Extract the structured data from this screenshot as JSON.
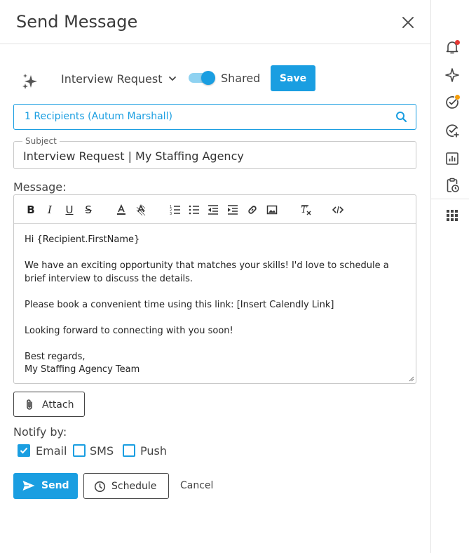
{
  "header": {
    "title": "Send Message"
  },
  "template": {
    "selected": "Interview Request",
    "shared_label": "Shared",
    "shared_on": true,
    "save_label": "Save"
  },
  "recipients": {
    "text": "1 Recipients (Autum Marshall)"
  },
  "subject": {
    "label": "Subject",
    "value": "Interview Request | My Staffing Agency"
  },
  "message": {
    "label": "Message:",
    "paragraphs": [
      "Hi {Recipient.FirstName}",
      "We have an exciting opportunity that matches your skills! I'd love to schedule a brief interview to discuss the details.",
      "Please book a convenient time using this link: [Insert Calendly Link]",
      "Looking forward to connecting with you soon!",
      "Best regards,\nMy Staffing Agency Team"
    ]
  },
  "toolbar": {
    "bold": "B",
    "italic": "I",
    "underline": "U",
    "strike": "S"
  },
  "attach_label": "Attach",
  "notify": {
    "label": "Notify by:",
    "options": [
      {
        "label": "Email",
        "checked": true
      },
      {
        "label": "SMS",
        "checked": false
      },
      {
        "label": "Push",
        "checked": false
      }
    ]
  },
  "actions": {
    "send_label": "Send",
    "schedule_label": "Schedule",
    "cancel_label": "Cancel"
  },
  "colors": {
    "accent": "#1a9ee1",
    "notification_red": "#e53935",
    "notification_orange": "#f59e0b"
  },
  "rail_icons": [
    "bell-icon",
    "sparkle-icon",
    "check-circle-icon",
    "check-circle-add-icon",
    "chart-icon",
    "clipboard-clock-icon",
    "grid-apps-icon"
  ]
}
